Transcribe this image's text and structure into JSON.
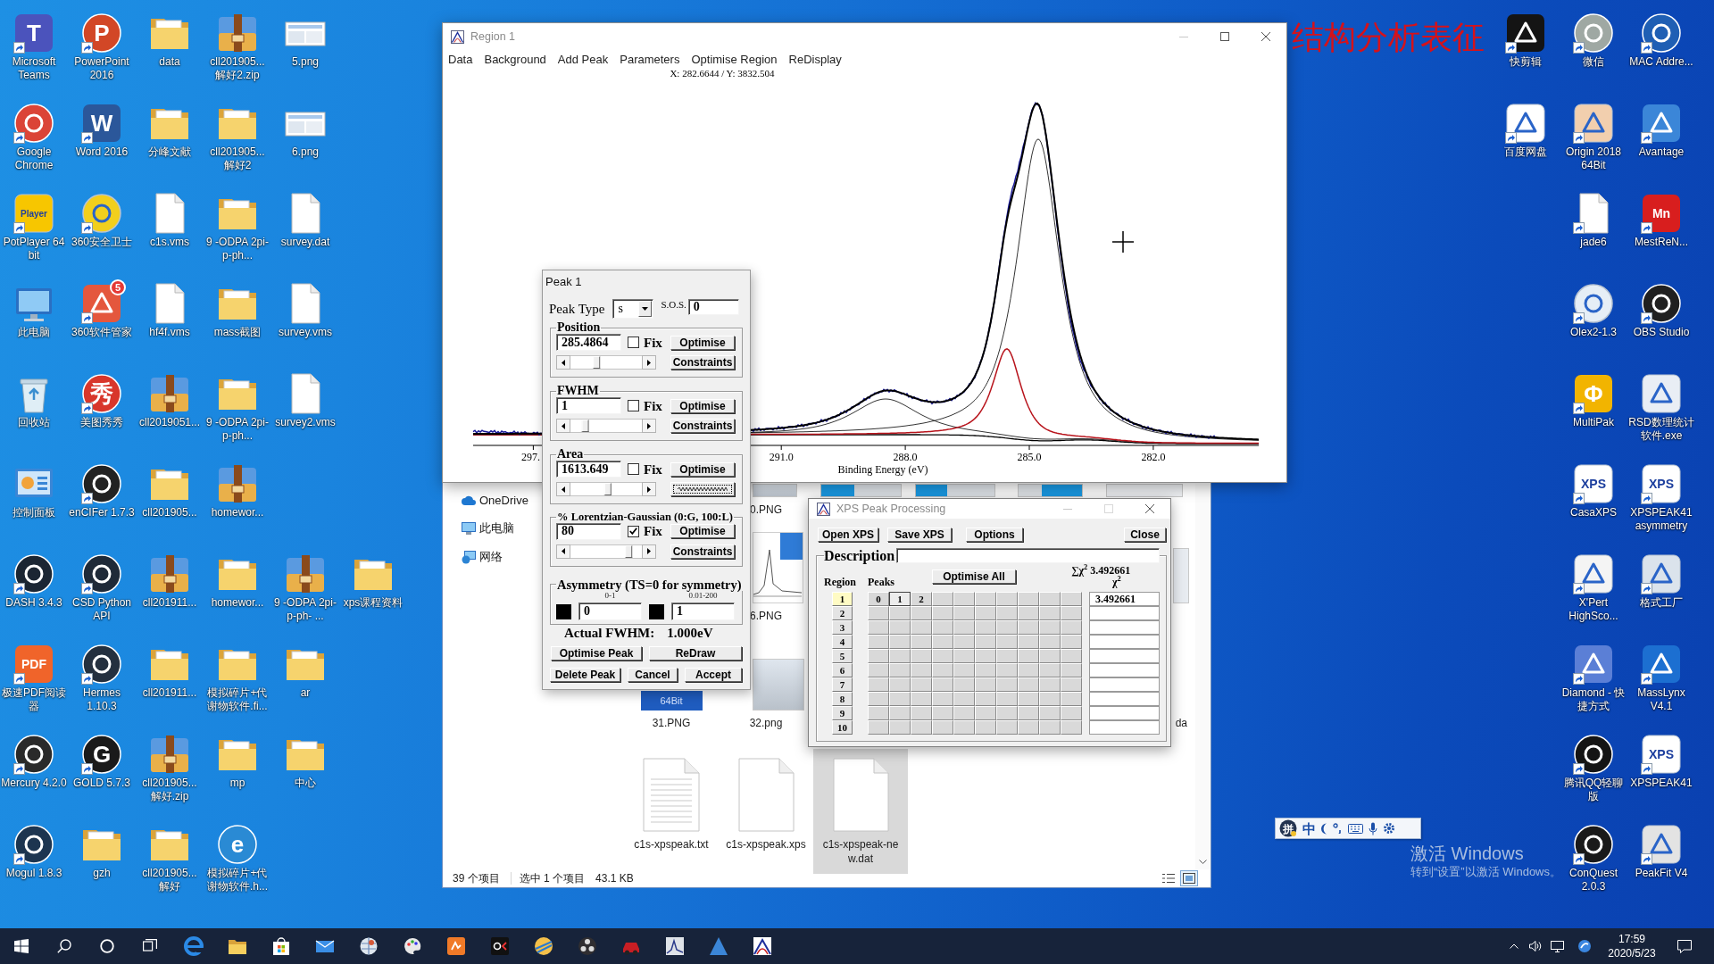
{
  "desktop": {
    "caption": "结构分析表征",
    "left_columns": [
      [
        {
          "label": "Microsoft Teams",
          "kind": "tile",
          "color": "#4b53bc",
          "glyph": "T",
          "shortcut": true
        },
        {
          "label": "Google Chrome",
          "kind": "disc",
          "color": "#db4437",
          "shortcut": true
        },
        {
          "label": "PotPlayer 64 bit",
          "kind": "tile",
          "color": "#f7c600",
          "glyph": "Player",
          "shortcut": true
        },
        {
          "label": "此电脑",
          "kind": "computer",
          "shortcut": false
        },
        {
          "label": "回收站",
          "kind": "bin",
          "shortcut": false
        },
        {
          "label": "控制面板",
          "kind": "panel",
          "shortcut": false
        },
        {
          "label": "DASH 3.4.3",
          "kind": "disc",
          "color": "#1b2633",
          "shortcut": true
        },
        {
          "label": "极速PDF阅读器",
          "kind": "tile",
          "color": "#f0642a",
          "glyph": "PDF",
          "shortcut": true
        },
        {
          "label": "Mercury 4.2.0",
          "kind": "disc",
          "color": "#2a2a2a",
          "shortcut": true
        },
        {
          "label": "Mogul 1.8.3",
          "kind": "disc",
          "color": "#1d3550",
          "shortcut": true
        }
      ],
      [
        {
          "label": "PowerPoint 2016",
          "kind": "disc",
          "color": "#d24726",
          "glyph": "P",
          "shortcut": true
        },
        {
          "label": "Word 2016",
          "kind": "tile",
          "color": "#2b579a",
          "glyph": "W",
          "shortcut": true
        },
        {
          "label": "360安全卫士",
          "kind": "disc",
          "color": "#f2cf1d",
          "shortcut": true
        },
        {
          "label": "360软件管家",
          "kind": "tile",
          "color": "#e4573d",
          "badge": "5",
          "shortcut": true
        },
        {
          "label": "美图秀秀",
          "kind": "disc",
          "color": "#d8362b",
          "glyph": "秀",
          "shortcut": true
        },
        {
          "label": "enCIFer 1.7.3",
          "kind": "disc",
          "color": "#222222",
          "shortcut": true
        },
        {
          "label": "CSD Python API",
          "kind": "disc",
          "color": "#1f2a38",
          "shortcut": true
        },
        {
          "label": "Hermes 1.10.3",
          "kind": "disc",
          "color": "#24303f",
          "shortcut": true
        },
        {
          "label": "GOLD 5.7.3",
          "kind": "disc",
          "color": "#1a1a1a",
          "glyph": "G",
          "shortcut": true
        },
        {
          "label": "gzh",
          "kind": "folder",
          "shortcut": false
        }
      ],
      [
        {
          "label": "data",
          "kind": "folder",
          "shortcut": false
        },
        {
          "label": "分峰文献",
          "kind": "folder",
          "shortcut": false
        },
        {
          "label": "c1s.vms",
          "kind": "document",
          "shortcut": false
        },
        {
          "label": "hf4f.vms",
          "kind": "document",
          "shortcut": false
        },
        {
          "label": "cll2019051...",
          "kind": "archive",
          "shortcut": false
        },
        {
          "label": "cll201905...",
          "kind": "folder",
          "shortcut": false
        },
        {
          "label": "cll201911...",
          "kind": "archive",
          "shortcut": false
        },
        {
          "label": "cll201911...",
          "kind": "folder",
          "shortcut": false
        },
        {
          "label": "cll201905... 解好.zip",
          "kind": "archive",
          "shortcut": false
        },
        {
          "label": "cll201905... 解好",
          "kind": "folder",
          "shortcut": false
        }
      ],
      [
        {
          "label": "cll201905... 解好2.zip",
          "kind": "archive",
          "shortcut": false
        },
        {
          "label": "cll201905... 解好2",
          "kind": "folder",
          "shortcut": false
        },
        {
          "label": "9 -ODPA 2pi-p-ph...",
          "kind": "folder",
          "shortcut": false
        },
        {
          "label": "mass截图",
          "kind": "folder",
          "shortcut": false
        },
        {
          "label": "9 -ODPA 2pi-p-ph...",
          "kind": "folder",
          "shortcut": false
        },
        {
          "label": "homewor...",
          "kind": "archive",
          "shortcut": false
        },
        {
          "label": "homewor...",
          "kind": "folder",
          "shortcut": false
        },
        {
          "label": "模拟碎片+代谢物软件.fi...",
          "kind": "folder",
          "shortcut": false
        },
        {
          "label": "mp",
          "kind": "folder",
          "shortcut": false
        },
        {
          "label": "模拟碎片+代谢物软件.h...",
          "kind": "disc",
          "color": "#2a8ad4",
          "glyph": "e",
          "shortcut": false
        }
      ],
      [
        {
          "label": "5.png",
          "kind": "picture",
          "shortcut": false
        },
        {
          "label": "6.png",
          "kind": "picture",
          "shortcut": false
        },
        {
          "label": "survey.dat",
          "kind": "document",
          "shortcut": false
        },
        {
          "label": "survey.vms",
          "kind": "document",
          "shortcut": false
        },
        {
          "label": "survey2.vms",
          "kind": "document",
          "shortcut": false
        },
        {
          "label": "9 -ODPA 2pi-p-ph- ...",
          "kind": "archive",
          "shortcut": false
        },
        {
          "label": "ar",
          "kind": "folder",
          "shortcut": false
        },
        {
          "label": "中心",
          "kind": "folder",
          "shortcut": false
        }
      ],
      [
        {
          "label": "xps课程资料",
          "kind": "folder",
          "shortcut": false
        }
      ]
    ],
    "right_columns": [
      [
        {
          "label": "快剪辑",
          "kind": "tile",
          "color": "#141414",
          "shortcut": true
        },
        {
          "label": "百度网盘",
          "kind": "tile",
          "color": "#ffffff",
          "shortcut": true
        }
      ],
      [
        {
          "label": "微信",
          "kind": "disc",
          "color": "#9fa8a3",
          "shortcut": true
        },
        {
          "label": "Origin 2018 64Bit",
          "kind": "tile",
          "color": "#f2cfae",
          "shortcut": true
        },
        {
          "label": "jade6",
          "kind": "document",
          "shortcut": true
        },
        {
          "label": "Olex2-1.3",
          "kind": "disc",
          "color": "#e6eef6",
          "shortcut": true
        },
        {
          "label": "MultiPak",
          "kind": "tile",
          "color": "#f2b400",
          "glyph": "Φ",
          "shortcut": true
        },
        {
          "label": "CasaXPS",
          "kind": "tile",
          "color": "#ffffff",
          "glyph": "XPS",
          "shortcut": true
        },
        {
          "label": "X'Pert HighSco...",
          "kind": "tile",
          "color": "#f4f4f4",
          "shortcut": true
        },
        {
          "label": "Diamond - 快捷方式",
          "kind": "tile",
          "color": "#5b7fd6",
          "shortcut": true
        },
        {
          "label": "腾讯QQ轻聊版",
          "kind": "disc",
          "color": "#151515",
          "shortcut": true
        },
        {
          "label": "ConQuest 2.0.3",
          "kind": "disc",
          "color": "#1a1a1a",
          "shortcut": true
        }
      ],
      [
        {
          "label": "MAC Addre...",
          "kind": "disc",
          "color": "#1f5fb4",
          "shortcut": true
        },
        {
          "label": "Avantage",
          "kind": "tile",
          "color": "#3b86d8",
          "shortcut": true
        },
        {
          "label": "MestReN...",
          "kind": "tile",
          "color": "#d81e1e",
          "glyph": "Mn",
          "shortcut": true
        },
        {
          "label": "OBS Studio",
          "kind": "disc",
          "color": "#202020",
          "shortcut": true
        },
        {
          "label": "RSD数理统计软件.exe",
          "kind": "tile",
          "color": "#e9eef5",
          "shortcut": false
        },
        {
          "label": "XPSPEAK41 asymmetry",
          "kind": "tile",
          "color": "#ffffff",
          "glyph": "XPS",
          "shortcut": true
        },
        {
          "label": "格式工厂",
          "kind": "tile",
          "color": "#dbe3ec",
          "shortcut": true
        },
        {
          "label": "MassLynx V4.1",
          "kind": "tile",
          "color": "#1c6fd1",
          "shortcut": true
        },
        {
          "label": "XPSPEAK41",
          "kind": "tile",
          "color": "#ffffff",
          "glyph": "XPS",
          "shortcut": true
        },
        {
          "label": "PeakFit V4",
          "kind": "tile",
          "color": "#e3e3e3",
          "shortcut": true
        }
      ]
    ],
    "activation": {
      "title": "激活 Windows",
      "hint": "转到“设置”以激活 Windows。"
    }
  },
  "region_window": {
    "title": "Region 1",
    "menu": [
      "Data",
      "Background",
      "Add Peak",
      "Parameters",
      "Optimise Region",
      "ReDisplay"
    ],
    "readout": "X: 282.6644 / Y: 3832.504",
    "x_ticks": [
      "297.",
      "291.0",
      "288.0",
      "285.0",
      "282.0"
    ],
    "x_label": "Binding Energy (eV)"
  },
  "explorer": {
    "nav": [
      {
        "label": "OneDrive",
        "kind": "cloud"
      },
      {
        "label": "此电脑",
        "kind": "computer"
      },
      {
        "label": "网络",
        "kind": "network"
      }
    ],
    "items": [
      {
        "label": "0.PNG",
        "kind": "image",
        "selected": false
      },
      {
        "label": "6.PNG",
        "kind": "chart",
        "selected": false
      },
      {
        "label": "31.PNG",
        "kind": "screen",
        "thumbnail_text": "64Bit",
        "selected": false
      },
      {
        "label": "32.png",
        "kind": "image",
        "selected": false
      },
      {
        "label": "da",
        "selected": false
      },
      {
        "label": "c1s-xpspeak.txt",
        "kind": "text",
        "selected": false
      },
      {
        "label": "c1s-xpspeak.xps",
        "kind": "blank",
        "selected": false
      },
      {
        "label": "c1s-xpspeak-new.dat",
        "kind": "blank",
        "selected": true
      }
    ],
    "status": [
      "39 个项目",
      "选中 1 个项目",
      "43.1 KB"
    ],
    "views": [
      {
        "kind": "details",
        "selected": false
      },
      {
        "kind": "icons",
        "selected": true
      }
    ]
  },
  "peak_dialog": {
    "title": "Peak 1",
    "peak_type_label": "Peak Type",
    "peak_type": "s",
    "sos_label": "S.O.S.",
    "sos": "0",
    "groups": [
      {
        "label": "Position",
        "value": "285.4864",
        "fix_label": "Fix",
        "fixed": false,
        "optimise": "Optimise",
        "constraints": "Constraints",
        "constraints_focused": false,
        "level": 0.35
      },
      {
        "label": "FWHM",
        "value": "1",
        "fix_label": "Fix",
        "fixed": false,
        "optimise": "Optimise",
        "constraints": "Constraints",
        "constraints_focused": false,
        "level": 0.18
      },
      {
        "label": "Area",
        "value": "1613.649",
        "fix_label": "Fix",
        "fixed": false,
        "optimise": "Optimise",
        "constraints_focused": true,
        "level": 0.52
      },
      {
        "label": "% Lorentzian-Gaussian (0:G, 100:L)",
        "value": "80",
        "fix_label": "Fix",
        "fixed": true,
        "optimise": "Optimise",
        "constraints": "Constraints",
        "constraints_focused": false,
        "level": 0.85
      }
    ],
    "asymmetry": {
      "label": "Asymmetry (TS=0 for symmetry)",
      "fields": [
        {
          "range": "0-1",
          "value": "0"
        },
        {
          "range": "0.01-200",
          "value": "1"
        }
      ]
    },
    "actual_fwhm_label": "Actual FWHM:",
    "actual_fwhm": "1.000eV",
    "button_rows": [
      [
        "Optimise Peak",
        "ReDraw"
      ],
      [
        "Delete Peak",
        "Cancel",
        "Accept"
      ]
    ]
  },
  "xps_window": {
    "title": "XPS Peak Processing",
    "buttons": [
      "Open XPS",
      "Save XPS",
      "Options"
    ],
    "close": "Close",
    "description_label": "Description",
    "region_label": "Region",
    "peaks_label": "Peaks",
    "optimise_all": "Optimise All",
    "sum_label": "∑χ$^{2}$",
    "sum_value": "3.492661",
    "chi_label": "χ$^{2}$",
    "regions": [
      {
        "label": "1",
        "selected": true,
        "peaks": [
          {
            "label": "0",
            "selected": false
          },
          {
            "label": "1",
            "selected": true
          },
          {
            "label": "2",
            "selected": false
          }
        ],
        "chi2": "3.492661"
      },
      {
        "label": "2",
        "selected": false
      },
      {
        "label": "3",
        "selected": false
      },
      {
        "label": "4",
        "selected": false
      },
      {
        "label": "5",
        "selected": false
      },
      {
        "label": "6",
        "selected": false
      },
      {
        "label": "7",
        "selected": false
      },
      {
        "label": "8",
        "selected": false
      },
      {
        "label": "9",
        "selected": false
      },
      {
        "label": "10",
        "selected": false
      }
    ]
  },
  "ime_bar": {
    "logo": "拼",
    "mode": "中"
  },
  "taskbar": {
    "time": "17:59",
    "date": "2020/5/23"
  }
}
